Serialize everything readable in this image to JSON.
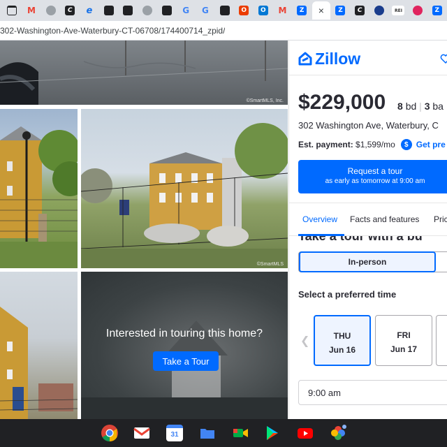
{
  "browser": {
    "url": "302-Washington-Ave-Waterbury-CT-06708/174400714_zpid/",
    "tabs": [
      {
        "icon": "window-icon",
        "letter": "",
        "color": "#3c4043"
      },
      {
        "icon": "gmail-icon",
        "letter": "M",
        "color": "#ea4335"
      },
      {
        "icon": "globe-icon",
        "letter": "",
        "color": "#5f6368"
      },
      {
        "icon": "script-c-icon",
        "letter": "C",
        "color": "#202124"
      },
      {
        "icon": "edge-e-icon",
        "letter": "e",
        "color": "#1a73e8"
      },
      {
        "icon": "window-icon",
        "letter": "",
        "color": "#202124"
      },
      {
        "icon": "window-icon",
        "letter": "",
        "color": "#202124"
      },
      {
        "icon": "globe-icon",
        "letter": "",
        "color": "#5f6368"
      },
      {
        "icon": "window-icon",
        "letter": "",
        "color": "#202124"
      },
      {
        "icon": "google-icon",
        "letter": "G",
        "color": "#4285f4"
      },
      {
        "icon": "google-icon",
        "letter": "G",
        "color": "#4285f4"
      },
      {
        "icon": "window-icon",
        "letter": "",
        "color": "#202124"
      },
      {
        "icon": "office-icon",
        "letter": "O",
        "color": "#eb3c00"
      },
      {
        "icon": "outlook-icon",
        "letter": "O",
        "color": "#0078d4"
      },
      {
        "icon": "gmail-icon",
        "letter": "M",
        "color": "#ea4335"
      },
      {
        "icon": "zillow-icon",
        "letter": "Z",
        "color": "#006aff"
      },
      {
        "icon": "close-icon",
        "letter": "×",
        "color": "#3c4043"
      },
      {
        "icon": "zillow-icon",
        "letter": "Z",
        "color": "#006aff"
      },
      {
        "icon": "script-c-icon",
        "letter": "C",
        "color": "#202124"
      },
      {
        "icon": "chat-icon",
        "letter": "",
        "color": "#1a3c8c"
      },
      {
        "icon": "rei-icon",
        "letter": "REI",
        "color": "#ffffff"
      },
      {
        "icon": "red-swirl-icon",
        "letter": "",
        "color": "#e0245e"
      },
      {
        "icon": "zillow-icon",
        "letter": "Z",
        "color": "#006aff"
      }
    ]
  },
  "photos": {
    "credit": "©SmartMLS, Inc.",
    "tour_prompt": "Interested in touring this home?",
    "tour_button": "Take a Tour"
  },
  "listing": {
    "brand": "Zillow",
    "price": "$229,000",
    "beds_num": "8",
    "beds_unit": "bd",
    "baths_num": "3",
    "baths_unit": "ba",
    "address": "302 Washington Ave, Waterbury, C",
    "est_label": "Est. payment:",
    "est_value": "$1,599/mo",
    "prequal": "Get pre",
    "request_title": "Request a tour",
    "request_sub": "as early as tomorrow at 9:00 am",
    "tabs": [
      "Overview",
      "Facts and features",
      "Pric"
    ],
    "section_heading": "Take a tour with a bu",
    "tour_type": "In-person",
    "select_time_label": "Select a preferred time",
    "days": [
      {
        "dow": "THU",
        "date": "Jun 16"
      },
      {
        "dow": "FRI",
        "date": "Jun 17"
      }
    ],
    "time_value": "9:00 am"
  },
  "shelf": {
    "apps": [
      "chrome-icon",
      "gmail-icon",
      "calendar-icon",
      "files-icon",
      "meet-icon",
      "play-store-icon",
      "youtube-icon",
      "photos-icon"
    ],
    "calendar_day": "31"
  },
  "colors": {
    "accent": "#006aff",
    "text": "#2a2a33",
    "shelf": "#202124"
  }
}
